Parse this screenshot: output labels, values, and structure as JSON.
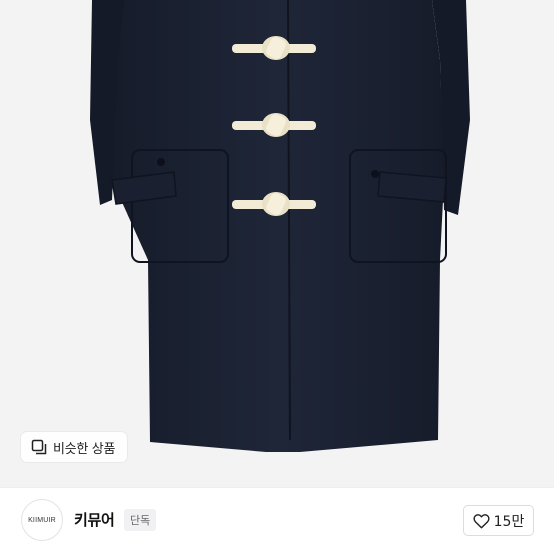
{
  "product_image": {
    "subject": "navy-duffle-coat"
  },
  "similar_products": {
    "label": "비슷한 상품",
    "icon": "similar-products-icon"
  },
  "brand": {
    "logo_text": "KIIMUIR",
    "name": "키뮤어",
    "badge": "단독"
  },
  "like": {
    "count": "15만",
    "icon": "heart-outline-icon"
  },
  "colors": {
    "coat": "#1c2333",
    "toggle": "#f2ecd6",
    "background": "#f3f3f4"
  }
}
